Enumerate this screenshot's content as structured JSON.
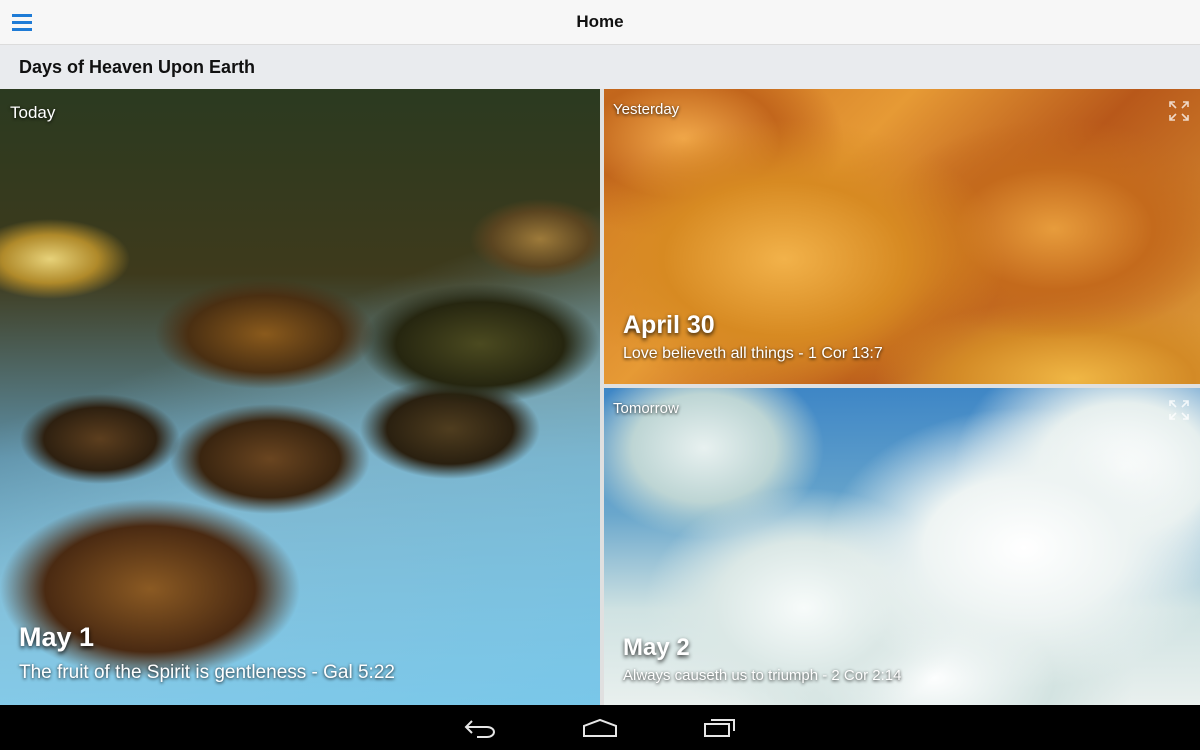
{
  "app_bar": {
    "title": "Home",
    "menu_icon": "hamburger-menu-icon",
    "accent_color": "#1e7bd6"
  },
  "subheader": {
    "title": "Days of Heaven Upon Earth"
  },
  "cards": {
    "today": {
      "day_label": "Today",
      "date": "May 1",
      "verse": "The fruit of the Spirit is gentleness - Gal 5:22",
      "background": "stream-rocks-image"
    },
    "yesterday": {
      "day_label": "Yesterday",
      "date": "April 30",
      "verse": "Love believeth all things - 1 Cor 13:7",
      "background": "autumn-leaves-image",
      "expand_icon": "expand-icon"
    },
    "tomorrow": {
      "day_label": "Tomorrow",
      "date": "May 2",
      "verse": "Always causeth us to triumph - 2 Cor 2:14",
      "background": "clouds-sky-image",
      "expand_icon": "expand-icon"
    }
  },
  "system_nav": {
    "back_icon": "back-icon",
    "home_icon": "home-icon",
    "recents_icon": "recent-apps-icon"
  }
}
